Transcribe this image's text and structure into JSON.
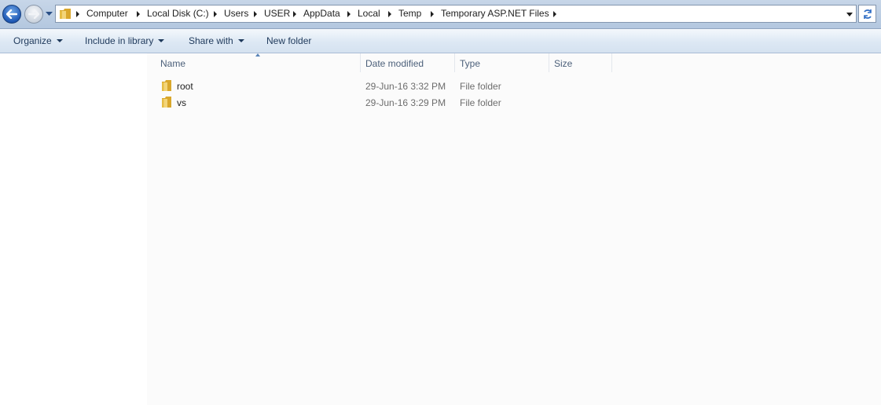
{
  "address_bar": {
    "breadcrumbs": [
      "Computer",
      "Local Disk (C:)",
      "Users",
      "USER",
      "AppData",
      "Local",
      "Temp",
      "Temporary ASP.NET Files"
    ]
  },
  "toolbar": {
    "organize": "Organize",
    "include_in_library": "Include in library",
    "share_with": "Share with",
    "new_folder": "New folder"
  },
  "columns": {
    "name": "Name",
    "date_modified": "Date modified",
    "type": "Type",
    "size": "Size"
  },
  "files": [
    {
      "name": "root",
      "date_modified": "29-Jun-16 3:32 PM",
      "type": "File folder",
      "size": ""
    },
    {
      "name": "vs",
      "date_modified": "29-Jun-16 3:29 PM",
      "type": "File folder",
      "size": ""
    }
  ],
  "colors": {
    "command_text": "#1e395b",
    "header_text": "#4c607a",
    "secondary_text": "#6d6d6d",
    "folder_yellow": "#e8c04a"
  }
}
